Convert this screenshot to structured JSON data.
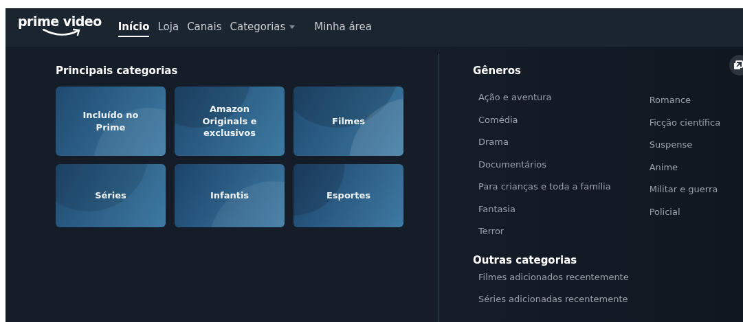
{
  "logo": {
    "text": "prime video"
  },
  "nav": [
    {
      "label": "Início",
      "selected": true,
      "dropdown": false
    },
    {
      "label": "Loja",
      "selected": false,
      "dropdown": false
    },
    {
      "label": "Canais",
      "selected": false,
      "dropdown": false
    },
    {
      "label": "Categorias",
      "selected": false,
      "dropdown": true
    },
    {
      "label": "Minha área",
      "selected": false,
      "dropdown": false
    }
  ],
  "main_categories": {
    "title": "Principais categorias",
    "tiles": [
      {
        "label": "Incluído no Prime"
      },
      {
        "label": "Amazon Originals e exclusivos"
      },
      {
        "label": "Filmes"
      },
      {
        "label": "Séries"
      },
      {
        "label": "Infantis"
      },
      {
        "label": "Esportes"
      }
    ]
  },
  "genres": {
    "title": "Gêneros",
    "column_1": [
      "Ação e aventura",
      "Comédia",
      "Drama",
      "Documentários",
      "Para crianças e toda a família",
      "Fantasia",
      "Terror"
    ],
    "column_2": [
      "Romance",
      "Ficção científica",
      "Suspense",
      "Anime",
      "Militar e guerra",
      "Policial"
    ]
  },
  "other_categories": {
    "title": "Outras categorias",
    "items": [
      "Filmes adicionados recentemente",
      "Séries adicionadas recentemente"
    ]
  }
}
